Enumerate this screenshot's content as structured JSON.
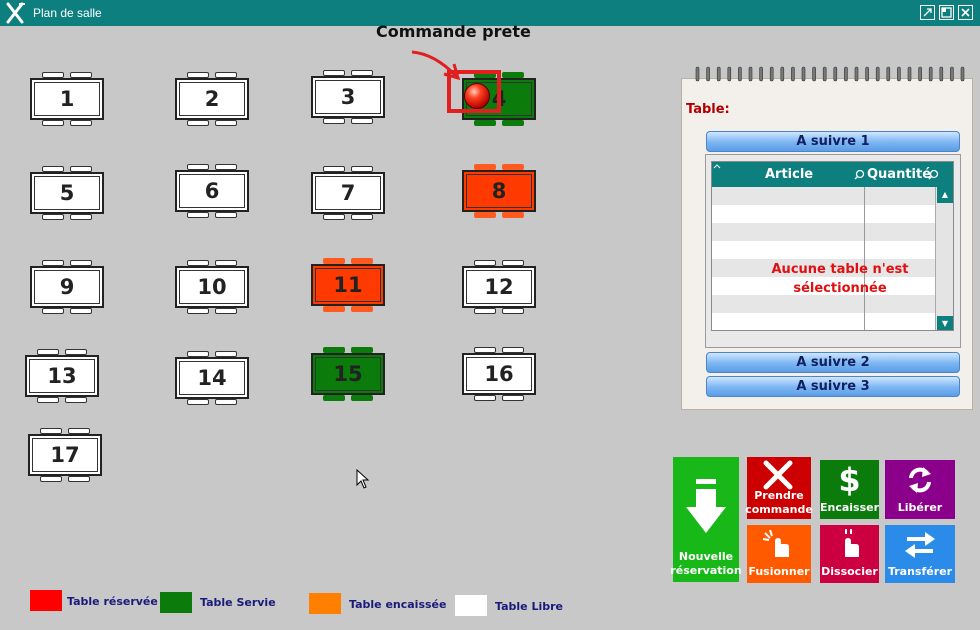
{
  "window": {
    "title": "Plan de salle"
  },
  "annotation": "Commande prete",
  "tables": [
    {
      "num": "1",
      "status": "libre"
    },
    {
      "num": "2",
      "status": "libre"
    },
    {
      "num": "3",
      "status": "libre"
    },
    {
      "num": "4",
      "status": "servie"
    },
    {
      "num": "5",
      "status": "libre"
    },
    {
      "num": "6",
      "status": "libre"
    },
    {
      "num": "7",
      "status": "libre"
    },
    {
      "num": "8",
      "status": "reservee"
    },
    {
      "num": "9",
      "status": "libre"
    },
    {
      "num": "10",
      "status": "libre"
    },
    {
      "num": "11",
      "status": "reservee"
    },
    {
      "num": "12",
      "status": "libre"
    },
    {
      "num": "13",
      "status": "libre"
    },
    {
      "num": "14",
      "status": "libre"
    },
    {
      "num": "15",
      "status": "servie"
    },
    {
      "num": "16",
      "status": "libre"
    },
    {
      "num": "17",
      "status": "libre"
    }
  ],
  "panel": {
    "table_label": "Table:",
    "sections": [
      "A suivre 1",
      "A suivre 2",
      "A suivre 3"
    ],
    "columns": [
      "Article",
      "Quantité"
    ],
    "empty_message_line1": "Aucune table n'est",
    "empty_message_line2": "sélectionnée"
  },
  "actions": {
    "nouvelle_reservation_1": "Nouvelle",
    "nouvelle_reservation_2": "réservation",
    "prendre_commande_1": "Prendre",
    "prendre_commande_2": "commande",
    "encaisser": "Encaisser",
    "liberer": "Libérer",
    "fusionner": "Fusionner",
    "dissocier": "Dissocier",
    "transferer": "Transférer"
  },
  "legend": [
    {
      "label": "Table réservée",
      "color": "#ff0000"
    },
    {
      "label": "Table Servie",
      "color": "#0b7b0b"
    },
    {
      "label": "Table encaissée",
      "color": "#ff8000"
    },
    {
      "label": "Table Libre",
      "color": "#ffffff"
    }
  ],
  "colors": {
    "titlebar": "#0d7f7f",
    "servie": "#0b7b0b",
    "reservee": "#ff3a00"
  }
}
